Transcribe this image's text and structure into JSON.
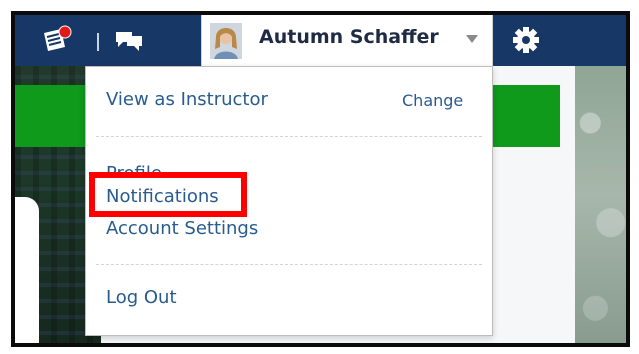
{
  "topbar": {
    "user_name": "Autumn Schaffer",
    "icons": [
      "notebook-alert-icon",
      "chat-bubbles-icon",
      "gear-icon"
    ],
    "colors": {
      "bar": "#173766",
      "alert_dot": "#e11a1a"
    }
  },
  "menu": {
    "view_as_label": "View as Instructor",
    "change_label": "Change",
    "profile_label": "Profile",
    "notifications_label": "Notifications",
    "account_settings_label": "Account Settings",
    "logout_label": "Log Out",
    "link_color": "#285b8f"
  },
  "annotation": {
    "highlight_color": "#ff0000"
  }
}
